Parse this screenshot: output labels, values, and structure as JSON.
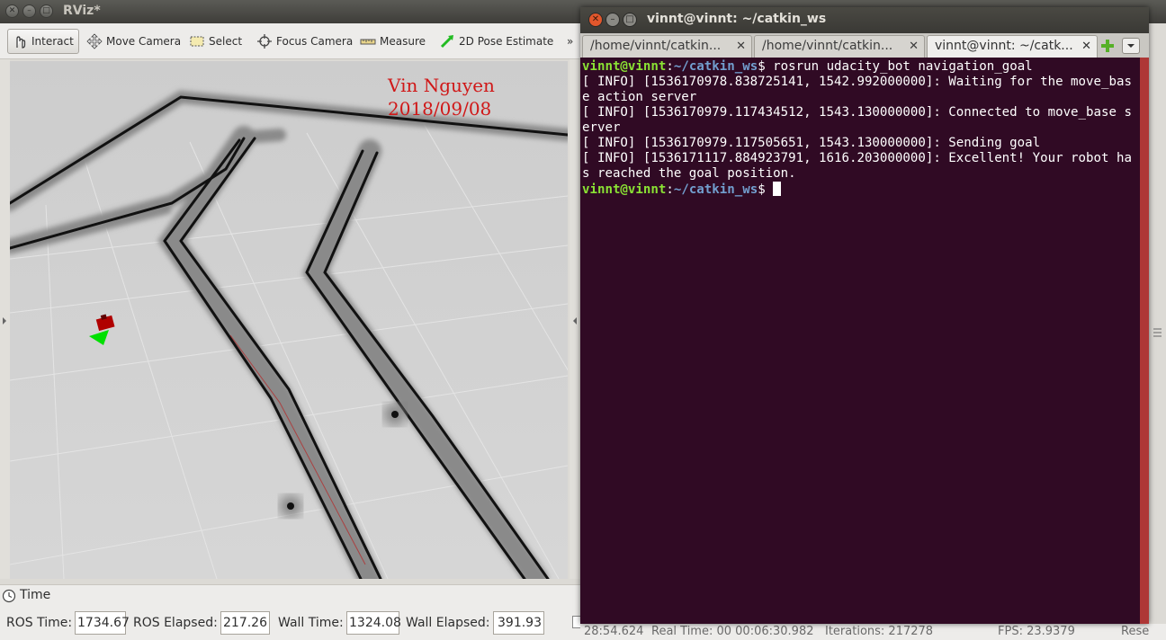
{
  "rviz": {
    "window_title": "RViz*",
    "toolbar": [
      {
        "label": "Interact",
        "icon": "interact-icon"
      },
      {
        "label": "Move Camera",
        "icon": "move-camera-icon"
      },
      {
        "label": "Select",
        "icon": "select-icon"
      },
      {
        "label": "Focus Camera",
        "icon": "focus-camera-icon"
      },
      {
        "label": "Measure",
        "icon": "measure-icon"
      },
      {
        "label": "2D Pose Estimate",
        "icon": "pose-estimate-icon"
      }
    ],
    "toolbar_overflow": "»",
    "watermark": {
      "line1": "Vin Nguyen",
      "line2": "2018/09/08"
    },
    "time_panel": {
      "title": "Time",
      "ros_time_label": "ROS Time:",
      "ros_time_value": "1734.67",
      "ros_elapsed_label": "ROS Elapsed:",
      "ros_elapsed_value": "217.26",
      "wall_time_label": "Wall Time:",
      "wall_time_value": "1324.08",
      "wall_elapsed_label": "Wall Elapsed:",
      "wall_elapsed_value": "391.93"
    },
    "status_bar": {
      "time_fragment": "28:54.624",
      "real_time": "Real Time:  00 00:06:30.982",
      "iterations": "Iterations:  217278",
      "fps": "FPS:  23.9379",
      "reset": "Rese"
    }
  },
  "terminal": {
    "title": "vinnt@vinnt: ~/catkin_ws",
    "tabs": [
      {
        "label": "/home/vinnt/catkin..."
      },
      {
        "label": "/home/vinnt/catkin..."
      },
      {
        "label": "vinnt@vinnt: ~/catk..."
      }
    ],
    "prompt_user": "vinnt@vinnt",
    "prompt_path": "~/catkin_ws",
    "command": " rosrun udacity_bot navigation_goal",
    "output": [
      "[ INFO] [1536170978.838725141, 1542.992000000]: Waiting for the move_base action server",
      "[ INFO] [1536170979.117434512, 1543.130000000]: Connected to move_base server",
      "[ INFO] [1536170979.117505651, 1543.130000000]: Sending goal",
      "[ INFO] [1536171117.884923791, 1616.203000000]: Excellent! Your robot has reached the goal position."
    ]
  },
  "colors": {
    "terminal_bg": "#300a24",
    "prompt_user": "#8ae234",
    "prompt_path": "#729fcf",
    "watermark": "#d01818",
    "robot": "#b00000",
    "pose_arrow": "#00e000"
  }
}
